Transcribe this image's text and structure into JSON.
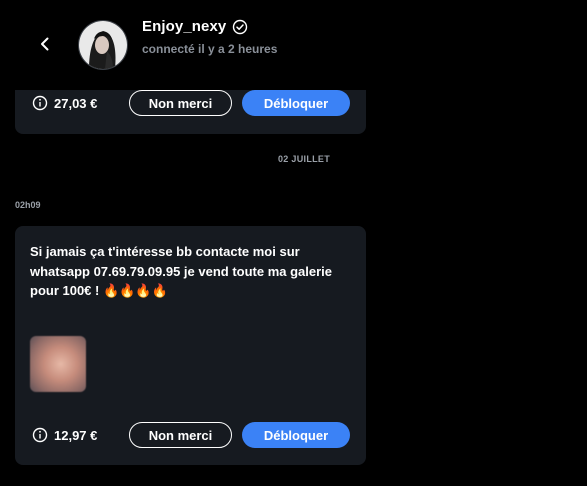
{
  "header": {
    "username": "Enjoy_nexy",
    "status": "connecté il y a 2 heures",
    "icons": {
      "back": "chevron-left-icon",
      "verified": "verified-check-icon",
      "avatar": "avatar-image"
    }
  },
  "top_card": {
    "price": "27,03 €",
    "decline_label": "Non merci",
    "unlock_label": "Débloquer"
  },
  "date_separator": "02 JUILLET",
  "message": {
    "time": "02h09",
    "text": "Si jamais ça t'intéresse bb contacte moi sur whatsapp 07.69.79.09.95 je vend toute ma galerie pour 100€ ! 🔥🔥🔥🔥",
    "price": "12,97 €",
    "decline_label": "Non merci",
    "unlock_label": "Débloquer",
    "media": "blurred-image-thumbnail"
  },
  "colors": {
    "background": "#000000",
    "card": "#161a20",
    "primary": "#3b82f6",
    "text": "#ffffff",
    "muted": "#9aa0a8"
  }
}
